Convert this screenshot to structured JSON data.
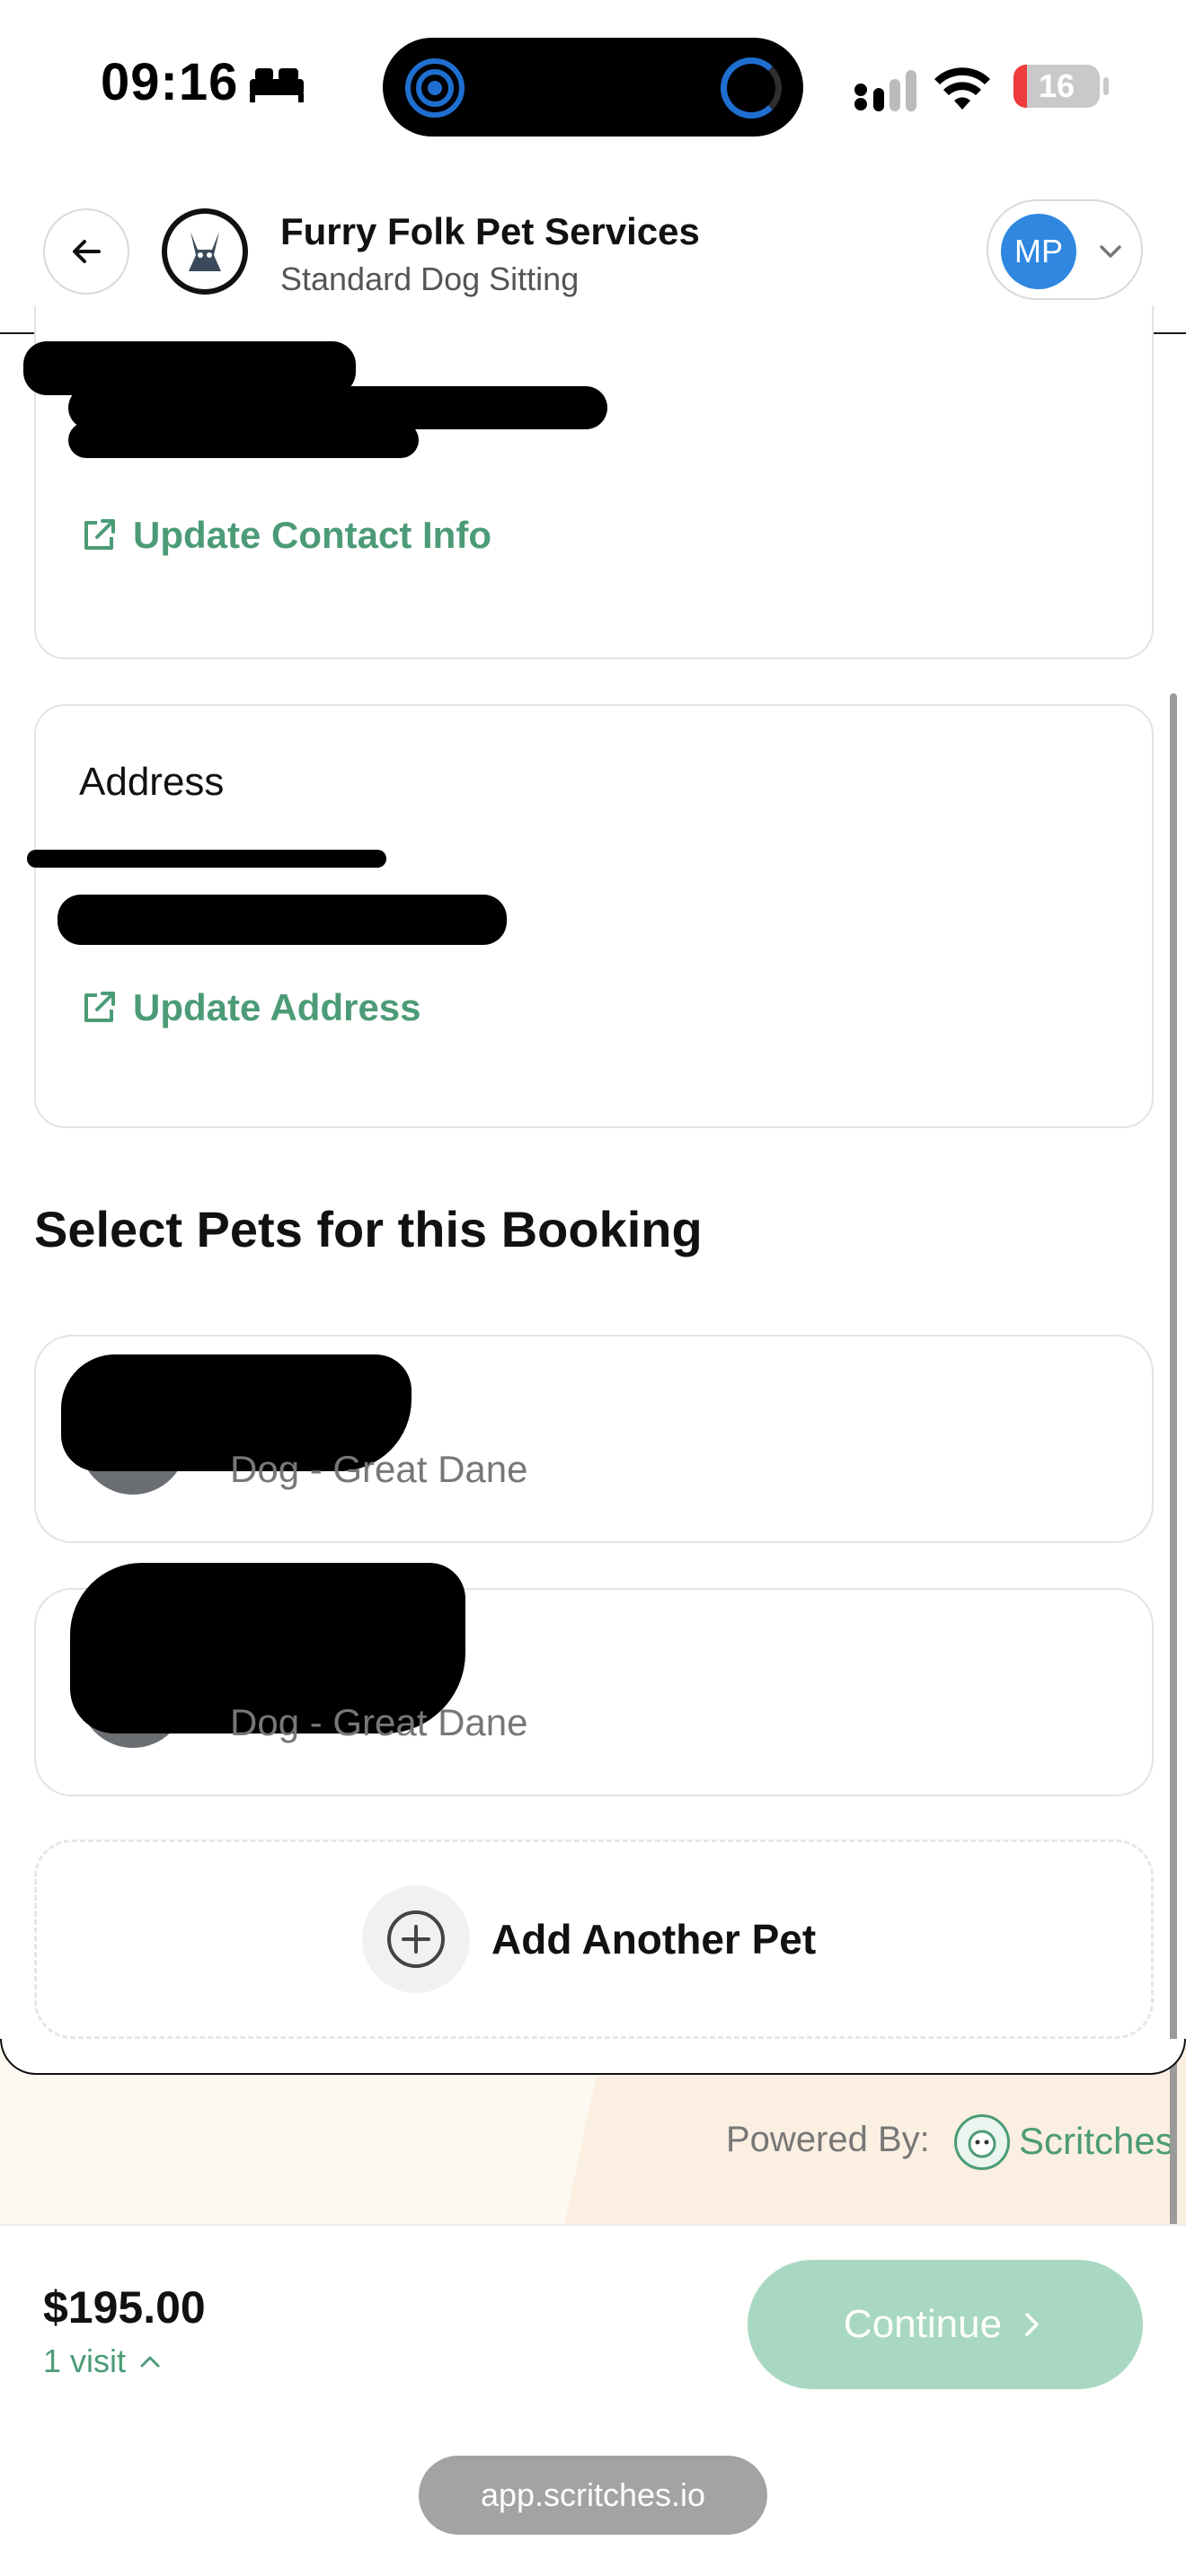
{
  "status_bar": {
    "time": "09:16",
    "battery": "16",
    "battery_level": 0.16,
    "colors": {
      "battery_low": "#ee3b3b",
      "activity": "#1f6fd1"
    }
  },
  "header": {
    "business_name": "Furry Folk Pet Services",
    "service_name": "Standard Dog Sitting",
    "user_initials": "MP"
  },
  "contact_card": {
    "link_label": "Update Contact Info"
  },
  "address_card": {
    "title": "Address",
    "link_label": "Update Address"
  },
  "pets_section": {
    "title": "Select Pets for this Booking",
    "pets": [
      {
        "breed": "Dog - Great Dane"
      },
      {
        "breed": "Dog - Great Dane"
      }
    ],
    "add_label": "Add Another Pet"
  },
  "powered": {
    "label": "Powered By:",
    "brand": "Scritches"
  },
  "footer": {
    "price": "$195.00",
    "visits": "1 visit",
    "continue_label": "Continue"
  },
  "browser": {
    "url": "app.scritches.io"
  },
  "theme": {
    "accent": "#4c9b77",
    "button_disabled": "#a9d8c2",
    "avatar": "#2f87e0"
  }
}
